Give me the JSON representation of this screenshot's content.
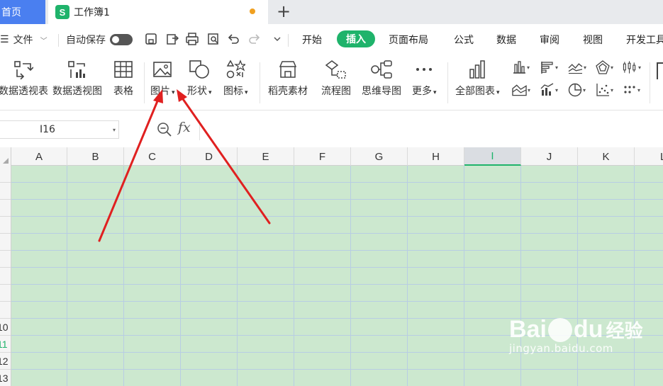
{
  "tabs": {
    "home": "首页",
    "document": "工作簿1",
    "new_tab_symbol": "+"
  },
  "menu": {
    "file": "文件",
    "autosave": "自动保存",
    "ribbon_tabs": [
      "开始",
      "插入",
      "页面布局",
      "公式",
      "数据",
      "审阅",
      "视图",
      "开发工具"
    ],
    "active_tab": "插入"
  },
  "ribbon": {
    "buttons": [
      "数据透视表",
      "数据透视图",
      "表格",
      "图片",
      "形状",
      "图标",
      "稻壳素材",
      "流程图",
      "思维导图",
      "更多",
      "全部图表"
    ],
    "dropdown_marker": "▾"
  },
  "formula_bar": {
    "cell_reference": "I16",
    "fx_label": "fx"
  },
  "grid": {
    "columns": [
      "A",
      "B",
      "C",
      "D",
      "E",
      "F",
      "G",
      "H",
      "I",
      "J",
      "K",
      "L"
    ],
    "selected_column": "I",
    "visible_row_numbers": [
      "10",
      "11",
      "12",
      "13"
    ],
    "selected_row": "11"
  },
  "watermark": {
    "brand": "Bai",
    "brand2": "du",
    "service": "经验",
    "url": "jingyan.baidu.com"
  },
  "colors": {
    "accent": "#1fb36b",
    "home_tab": "#4a7ff0",
    "cell_background": "#cce8cf",
    "arrow": "#e02020"
  }
}
